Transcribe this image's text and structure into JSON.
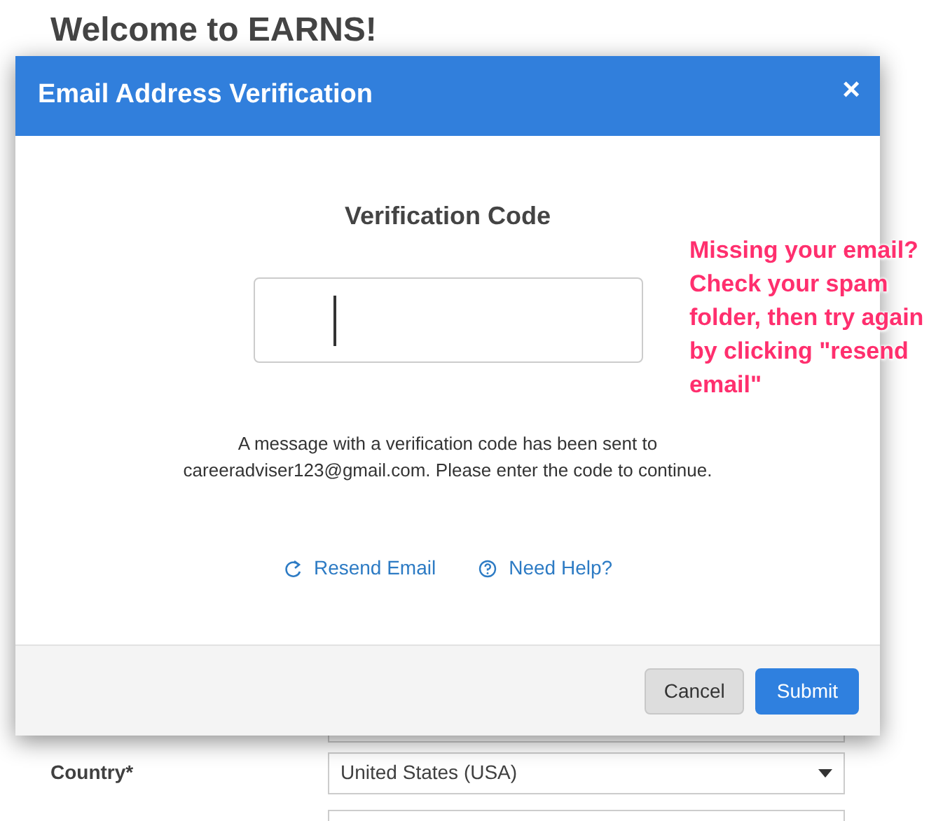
{
  "page": {
    "heading": "Welcome to EARNS!",
    "fields": [
      {
        "label": "Country*",
        "value": "United States (USA)"
      }
    ]
  },
  "modal": {
    "title": "Email Address Verification",
    "close": "×",
    "code_label": "Verification Code",
    "message": "A message with a verification code has been sent to careeradviser123@gmail.com. Please enter the code to continue.",
    "links": [
      {
        "kind": "resend",
        "label": "Resend Email"
      },
      {
        "kind": "help",
        "label": "Need Help?"
      }
    ],
    "buttons": [
      {
        "kind": "secondary",
        "label": "Cancel"
      },
      {
        "kind": "primary",
        "label": "Submit"
      }
    ]
  },
  "annotation": "Missing your email? Check your spam folder, then try again by clicking \"resend email\""
}
